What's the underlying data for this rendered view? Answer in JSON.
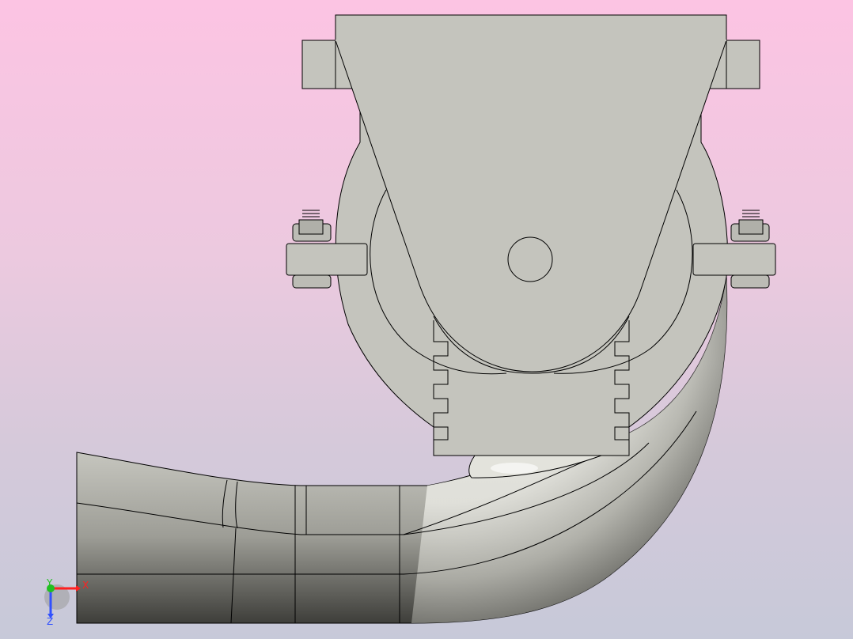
{
  "app": {
    "view": "3D CAD viewport",
    "background_top": "#fcc4e3",
    "background_bottom": "#c7c9d9"
  },
  "model": {
    "description_icon": "pipe-elbow-with-valve-housing",
    "part_color": "#c4c4bd",
    "edge_color": "#000000"
  },
  "triad": {
    "x_label": "X",
    "y_label": "Y",
    "z_label": "Z",
    "x_color": "#ff2020",
    "y_color": "#20c020",
    "z_color": "#3050ff"
  }
}
